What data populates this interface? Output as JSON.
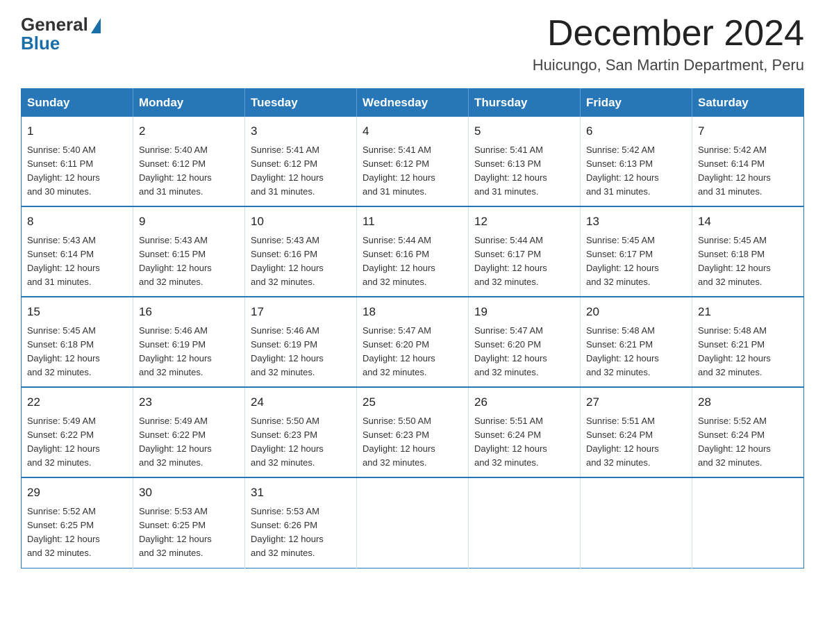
{
  "logo": {
    "general": "General",
    "blue": "Blue"
  },
  "title": "December 2024",
  "location": "Huicungo, San Martin Department, Peru",
  "days_of_week": [
    "Sunday",
    "Monday",
    "Tuesday",
    "Wednesday",
    "Thursday",
    "Friday",
    "Saturday"
  ],
  "weeks": [
    [
      {
        "day": "1",
        "sunrise": "5:40 AM",
        "sunset": "6:11 PM",
        "daylight": "12 hours and 30 minutes."
      },
      {
        "day": "2",
        "sunrise": "5:40 AM",
        "sunset": "6:12 PM",
        "daylight": "12 hours and 31 minutes."
      },
      {
        "day": "3",
        "sunrise": "5:41 AM",
        "sunset": "6:12 PM",
        "daylight": "12 hours and 31 minutes."
      },
      {
        "day": "4",
        "sunrise": "5:41 AM",
        "sunset": "6:12 PM",
        "daylight": "12 hours and 31 minutes."
      },
      {
        "day": "5",
        "sunrise": "5:41 AM",
        "sunset": "6:13 PM",
        "daylight": "12 hours and 31 minutes."
      },
      {
        "day": "6",
        "sunrise": "5:42 AM",
        "sunset": "6:13 PM",
        "daylight": "12 hours and 31 minutes."
      },
      {
        "day": "7",
        "sunrise": "5:42 AM",
        "sunset": "6:14 PM",
        "daylight": "12 hours and 31 minutes."
      }
    ],
    [
      {
        "day": "8",
        "sunrise": "5:43 AM",
        "sunset": "6:14 PM",
        "daylight": "12 hours and 31 minutes."
      },
      {
        "day": "9",
        "sunrise": "5:43 AM",
        "sunset": "6:15 PM",
        "daylight": "12 hours and 32 minutes."
      },
      {
        "day": "10",
        "sunrise": "5:43 AM",
        "sunset": "6:16 PM",
        "daylight": "12 hours and 32 minutes."
      },
      {
        "day": "11",
        "sunrise": "5:44 AM",
        "sunset": "6:16 PM",
        "daylight": "12 hours and 32 minutes."
      },
      {
        "day": "12",
        "sunrise": "5:44 AM",
        "sunset": "6:17 PM",
        "daylight": "12 hours and 32 minutes."
      },
      {
        "day": "13",
        "sunrise": "5:45 AM",
        "sunset": "6:17 PM",
        "daylight": "12 hours and 32 minutes."
      },
      {
        "day": "14",
        "sunrise": "5:45 AM",
        "sunset": "6:18 PM",
        "daylight": "12 hours and 32 minutes."
      }
    ],
    [
      {
        "day": "15",
        "sunrise": "5:45 AM",
        "sunset": "6:18 PM",
        "daylight": "12 hours and 32 minutes."
      },
      {
        "day": "16",
        "sunrise": "5:46 AM",
        "sunset": "6:19 PM",
        "daylight": "12 hours and 32 minutes."
      },
      {
        "day": "17",
        "sunrise": "5:46 AM",
        "sunset": "6:19 PM",
        "daylight": "12 hours and 32 minutes."
      },
      {
        "day": "18",
        "sunrise": "5:47 AM",
        "sunset": "6:20 PM",
        "daylight": "12 hours and 32 minutes."
      },
      {
        "day": "19",
        "sunrise": "5:47 AM",
        "sunset": "6:20 PM",
        "daylight": "12 hours and 32 minutes."
      },
      {
        "day": "20",
        "sunrise": "5:48 AM",
        "sunset": "6:21 PM",
        "daylight": "12 hours and 32 minutes."
      },
      {
        "day": "21",
        "sunrise": "5:48 AM",
        "sunset": "6:21 PM",
        "daylight": "12 hours and 32 minutes."
      }
    ],
    [
      {
        "day": "22",
        "sunrise": "5:49 AM",
        "sunset": "6:22 PM",
        "daylight": "12 hours and 32 minutes."
      },
      {
        "day": "23",
        "sunrise": "5:49 AM",
        "sunset": "6:22 PM",
        "daylight": "12 hours and 32 minutes."
      },
      {
        "day": "24",
        "sunrise": "5:50 AM",
        "sunset": "6:23 PM",
        "daylight": "12 hours and 32 minutes."
      },
      {
        "day": "25",
        "sunrise": "5:50 AM",
        "sunset": "6:23 PM",
        "daylight": "12 hours and 32 minutes."
      },
      {
        "day": "26",
        "sunrise": "5:51 AM",
        "sunset": "6:24 PM",
        "daylight": "12 hours and 32 minutes."
      },
      {
        "day": "27",
        "sunrise": "5:51 AM",
        "sunset": "6:24 PM",
        "daylight": "12 hours and 32 minutes."
      },
      {
        "day": "28",
        "sunrise": "5:52 AM",
        "sunset": "6:24 PM",
        "daylight": "12 hours and 32 minutes."
      }
    ],
    [
      {
        "day": "29",
        "sunrise": "5:52 AM",
        "sunset": "6:25 PM",
        "daylight": "12 hours and 32 minutes."
      },
      {
        "day": "30",
        "sunrise": "5:53 AM",
        "sunset": "6:25 PM",
        "daylight": "12 hours and 32 minutes."
      },
      {
        "day": "31",
        "sunrise": "5:53 AM",
        "sunset": "6:26 PM",
        "daylight": "12 hours and 32 minutes."
      },
      null,
      null,
      null,
      null
    ]
  ],
  "labels": {
    "sunrise": "Sunrise:",
    "sunset": "Sunset:",
    "daylight": "Daylight:"
  }
}
